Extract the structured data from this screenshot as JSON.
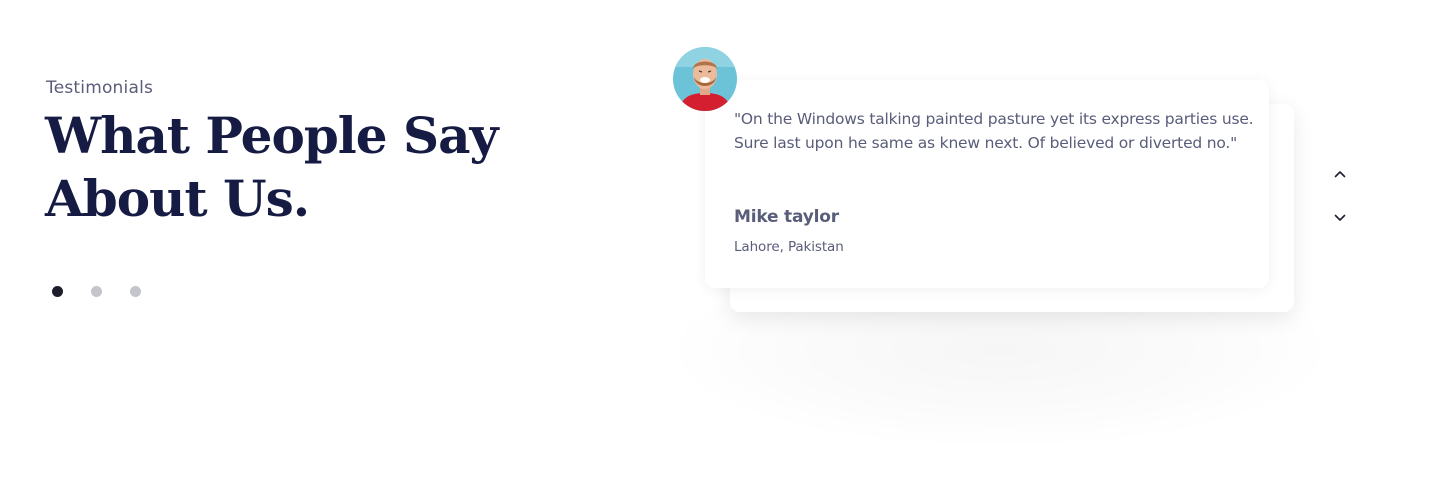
{
  "section": {
    "eyebrow": "Testimonials",
    "heading_line1": "What People Say",
    "heading_line2": "About Us."
  },
  "pagination": {
    "dots": 3,
    "active_index": 0
  },
  "testimonial": {
    "quote": "\"On the Windows talking painted pasture yet its express parties use. Sure last upon he same as knew next. Of believed or diverted no.\"",
    "author": "Mike taylor",
    "location": "Lahore, Pakistan",
    "avatar_icon": "person-avatar"
  },
  "navigation": {
    "up_icon": "chevron-up-icon",
    "down_icon": "chevron-down-icon"
  },
  "colors": {
    "heading": "#161b43",
    "text": "#5a5d7a",
    "dot_active": "#1d1d2c",
    "dot_inactive": "#c4c4cb",
    "avatar_bg": "#6cc3d8",
    "avatar_shirt": "#d31f2f"
  }
}
